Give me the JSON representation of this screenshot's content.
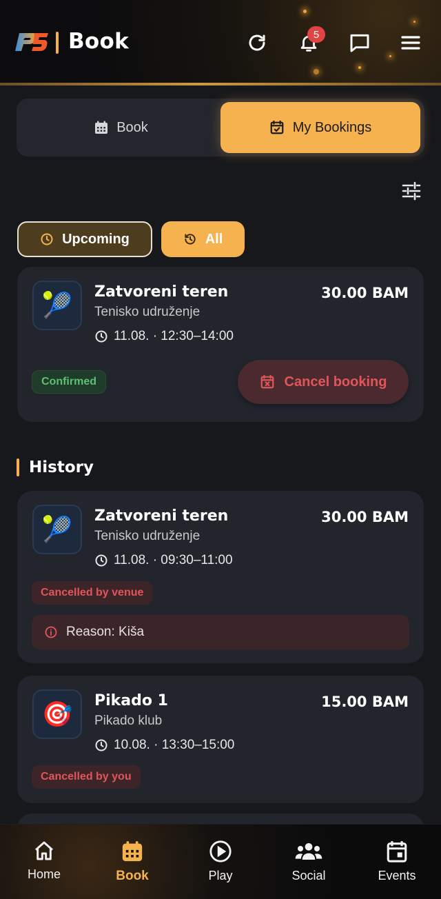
{
  "header": {
    "title": "Book",
    "logo_text": "P5",
    "notification_count": "5",
    "icons": [
      "refresh-icon",
      "bell-icon",
      "chat-icon",
      "menu-icon"
    ]
  },
  "segments": {
    "book_label": "Book",
    "my_bookings_label": "My Bookings",
    "active": "My Bookings"
  },
  "filters": {
    "upcoming_label": "Upcoming",
    "all_label": "All"
  },
  "upcoming": [
    {
      "title": "Zatvoreni teren",
      "venue": "Tenisko udruženje",
      "time": "11.08. · 12:30–14:00",
      "price": "30.00 BAM",
      "status": "Confirmed",
      "action_label": "Cancel booking",
      "icon": "tennis-icon"
    }
  ],
  "history": {
    "title": "History",
    "items": [
      {
        "title": "Zatvoreni teren",
        "venue": "Tenisko udruženje",
        "time": "11.08. · 09:30–11:00",
        "price": "30.00 BAM",
        "status": "Cancelled by venue",
        "reason": "Reason: Kiša",
        "icon": "tennis-icon"
      },
      {
        "title": "Pikado 1",
        "venue": "Pikado klub",
        "time": "10.08. · 13:30–15:00",
        "price": "15.00 BAM",
        "status": "Cancelled by you",
        "icon": "darts-icon"
      }
    ]
  },
  "nav": {
    "items": [
      {
        "label": "Home",
        "icon": "home-icon"
      },
      {
        "label": "Book",
        "icon": "calendar-icon",
        "active": true
      },
      {
        "label": "Play",
        "icon": "play-icon"
      },
      {
        "label": "Social",
        "icon": "people-icon"
      },
      {
        "label": "Events",
        "icon": "event-icon"
      }
    ]
  },
  "colors": {
    "accent": "#f6b24e",
    "background": "#17181c",
    "card": "#22252c",
    "danger": "#e0565a",
    "success": "#5fbf74"
  }
}
